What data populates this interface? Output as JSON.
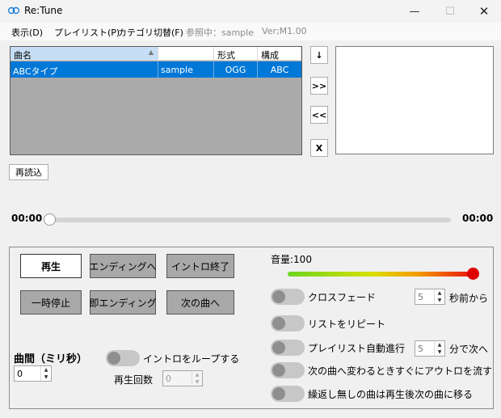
{
  "window": {
    "title": "Re:Tune",
    "icon": "link-icon",
    "minimize": "—",
    "maximize": "☐",
    "close": "✕"
  },
  "menu": {
    "items": [
      {
        "label": "表示(D)"
      },
      {
        "label": "プレイリスト(P)"
      },
      {
        "label": "カテゴリ切替(F)"
      },
      {
        "label": "参照中：sample"
      },
      {
        "label": "Ver;M1.00"
      }
    ]
  },
  "table": {
    "columns": [
      "曲名",
      "",
      "形式",
      "構成"
    ],
    "rows": [
      {
        "name": "ABCタイプ",
        "category": "sample",
        "format": "OGG",
        "structure": "ABC"
      }
    ]
  },
  "side_buttons": {
    "down": "↓",
    "add": ">>",
    "remove": "<<",
    "delete": "X"
  },
  "reload_label": "再読込",
  "seek": {
    "current": "00:00",
    "total": "00:00",
    "position_percent": 0
  },
  "controls": {
    "play": "再生",
    "ending": "エンディングへ",
    "intro_end": "イントロ終了",
    "pause": "一時停止",
    "instant_ending": "即エンディング",
    "next_song": "次の曲へ"
  },
  "volume": {
    "label": "音量:100",
    "value": 100
  },
  "interval": {
    "label": "曲間（ミリ秒）",
    "value": "0"
  },
  "intro_loop": {
    "label": "イントロをループする",
    "count_label": "再生回数",
    "count_value": "0"
  },
  "options": {
    "crossfade": {
      "label": "クロスフェード",
      "value": "5",
      "suffix": "秒前から"
    },
    "repeat_list": {
      "label": "リストをリピート"
    },
    "auto_advance": {
      "label": "プレイリスト自動進行",
      "value": "5",
      "suffix": "分で次へ"
    },
    "outro_on_change": {
      "label": "次の曲へ変わるときすぐにアウトロを流す"
    },
    "no_repeat_next": {
      "label": "繰返し無しの曲は再生後次の曲に移る"
    }
  },
  "colors": {
    "selection": "#0078d7",
    "volume_knob": "#e00000",
    "button_gray": "#a8a8a8"
  }
}
